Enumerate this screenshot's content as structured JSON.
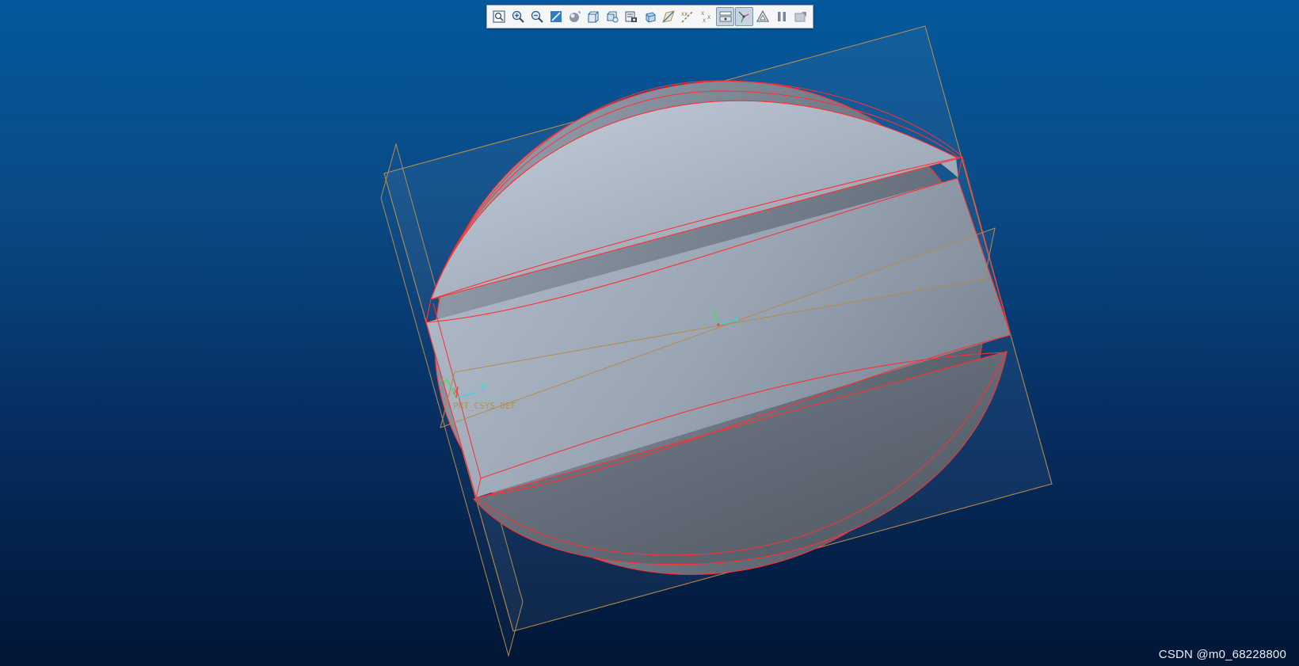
{
  "toolbar": {
    "items": [
      {
        "name": "refit-icon",
        "active": false
      },
      {
        "name": "zoom-in-icon",
        "active": false
      },
      {
        "name": "zoom-out-icon",
        "active": false
      },
      {
        "name": "repaint-icon",
        "active": false
      },
      {
        "name": "display-style-icon",
        "active": false
      },
      {
        "name": "saved-orientations-icon",
        "active": false
      },
      {
        "name": "view-manager-icon",
        "active": false
      },
      {
        "name": "snapshot-icon",
        "active": false
      },
      {
        "name": "perspective-view-icon",
        "active": false
      },
      {
        "name": "plane-display-icon",
        "active": false
      },
      {
        "name": "axis-display-icon",
        "active": false
      },
      {
        "name": "point-display-icon",
        "active": true
      },
      {
        "name": "csys-display-icon",
        "active": true
      },
      {
        "name": "annotation-display-icon",
        "active": false
      },
      {
        "name": "pause-icon",
        "active": false
      },
      {
        "name": "spin-center-icon",
        "active": false
      }
    ]
  },
  "model": {
    "csys_label": "PRT_CSYS_DEF",
    "axis_label_z": "Z",
    "axis_label_y": "Y",
    "axis_label_x": "X",
    "colors": {
      "edge": "#ff3030",
      "datum_plane": "#b58a4a",
      "surface_light": "#b8c3d2",
      "surface_dark": "#5c6470"
    }
  },
  "watermark": "CSDN @m0_68228800"
}
